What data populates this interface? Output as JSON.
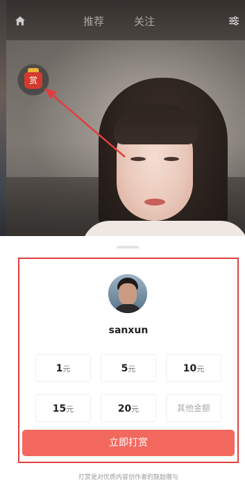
{
  "topnav": {
    "tabs": [
      {
        "label": "推荐"
      },
      {
        "label": "关注"
      }
    ],
    "home_icon": "home-icon",
    "filter_icon": "filter-icon"
  },
  "floating_tip": {
    "label": "赏",
    "icon": "red-envelope-icon"
  },
  "sheet": {
    "username": "sanxun",
    "amounts": [
      {
        "value": "1",
        "unit": "元"
      },
      {
        "value": "5",
        "unit": "元"
      },
      {
        "value": "10",
        "unit": "元"
      },
      {
        "value": "15",
        "unit": "元"
      },
      {
        "value": "20",
        "unit": "元"
      }
    ],
    "other_amount_label": "其他金额",
    "submit_label": "立即打赏",
    "footnote": "打赏是对优质内容创作者的鼓励赠与"
  },
  "colors": {
    "accent": "#f3685e",
    "highlight_border": "#e23d3d",
    "annotation_arrow": "#e23d3d"
  }
}
